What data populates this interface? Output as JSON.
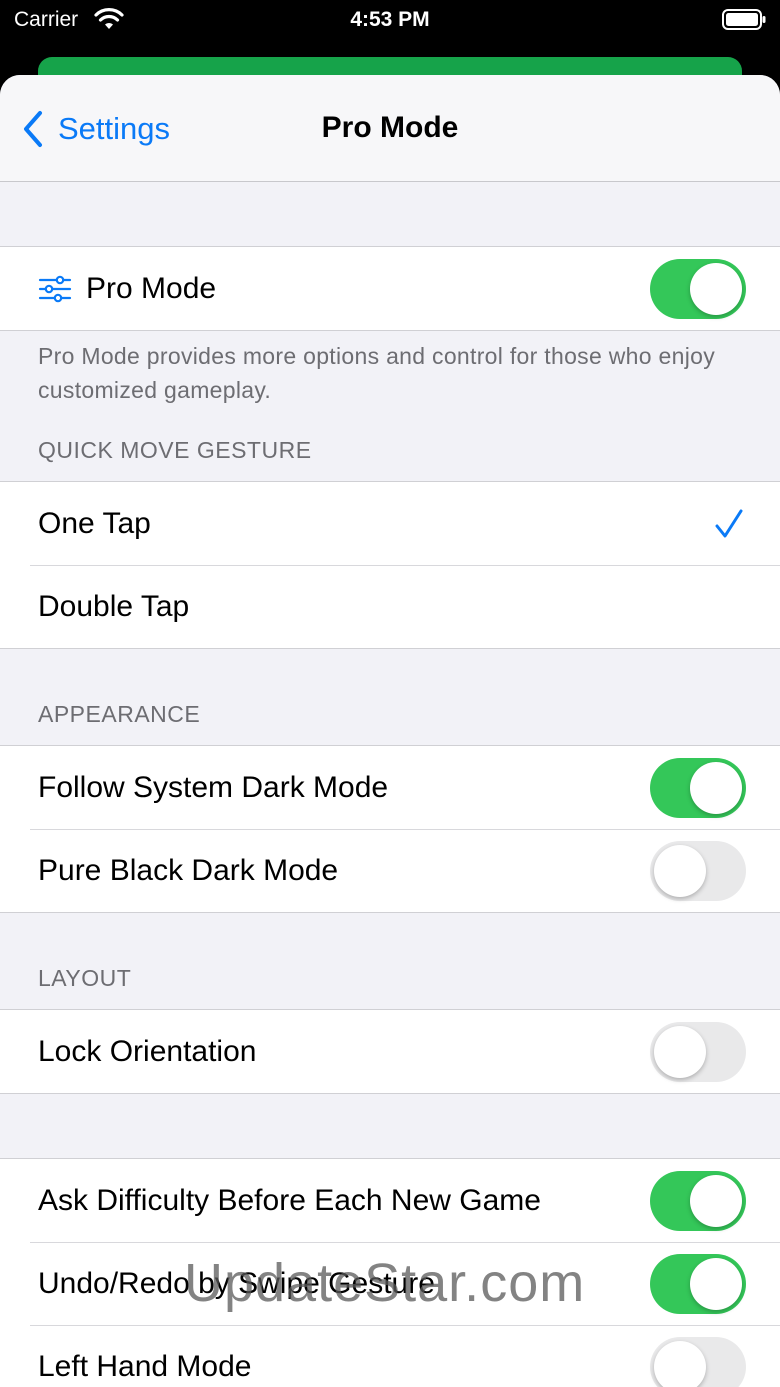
{
  "status_bar": {
    "carrier": "Carrier",
    "time": "4:53 PM"
  },
  "nav": {
    "back_label": "Settings",
    "title": "Pro Mode"
  },
  "pro_mode": {
    "label": "Pro Mode",
    "icon": "sliders-icon",
    "on": true,
    "footer": "Pro Mode provides more options and control for those who enjoy customized gameplay."
  },
  "quick_move": {
    "header": "QUICK MOVE GESTURE",
    "options": [
      {
        "label": "One Tap",
        "selected": true
      },
      {
        "label": "Double Tap",
        "selected": false
      }
    ]
  },
  "appearance": {
    "header": "APPEARANCE",
    "items": [
      {
        "label": "Follow System Dark Mode",
        "on": true
      },
      {
        "label": "Pure Black Dark Mode",
        "on": false
      }
    ]
  },
  "layout": {
    "header": "LAYOUT",
    "items": [
      {
        "label": "Lock Orientation",
        "on": false
      }
    ]
  },
  "gameplay": {
    "items": [
      {
        "label": "Ask Difficulty Before Each New Game",
        "on": true
      },
      {
        "label": "Undo/Redo by Swipe Gesture",
        "on": true
      },
      {
        "label": "Left Hand Mode",
        "on": false
      }
    ]
  },
  "watermark": "UpdateStar.com",
  "colors": {
    "accent": "#0a7af7",
    "toggle_on": "#34c759",
    "toggle_off": "#e9e9ea",
    "banner": "#16a34a"
  }
}
